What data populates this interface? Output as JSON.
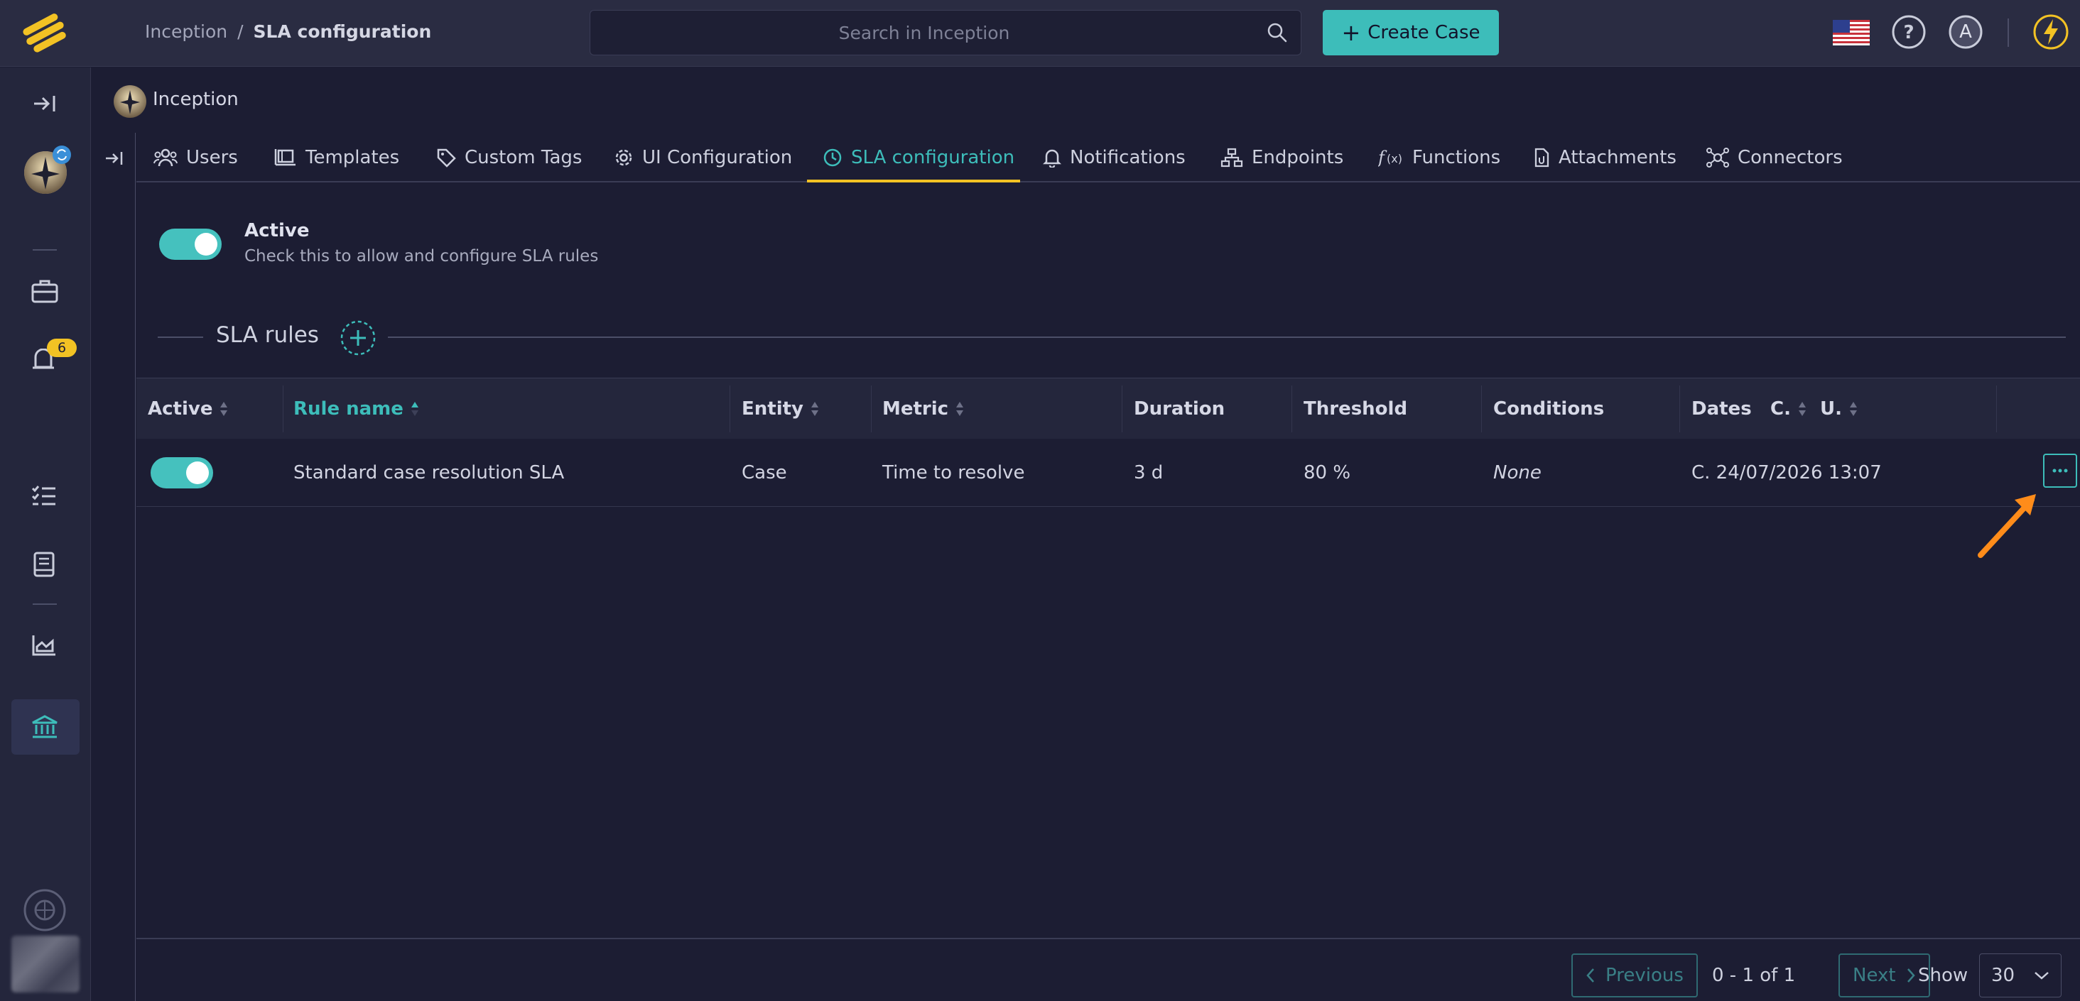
{
  "breadcrumb": {
    "root": "Inception",
    "separator": "/",
    "current": "SLA configuration"
  },
  "search": {
    "placeholder": "Search in Inception"
  },
  "header": {
    "create_label": "Create Case"
  },
  "user": {
    "initial": "A"
  },
  "sidebar": {
    "notification_count": "6"
  },
  "workspace": {
    "name": "Inception"
  },
  "tabs": [
    {
      "label": "Users",
      "icon": "users-icon"
    },
    {
      "label": "Templates",
      "icon": "templates-icon"
    },
    {
      "label": "Custom Tags",
      "icon": "tag-icon"
    },
    {
      "label": "UI Configuration",
      "icon": "gear-icon"
    },
    {
      "label": "SLA configuration",
      "icon": "clock-icon",
      "active": true
    },
    {
      "label": "Notifications",
      "icon": "bell-icon"
    },
    {
      "label": "Endpoints",
      "icon": "endpoints-icon"
    },
    {
      "label": "Functions",
      "icon": "function-icon"
    },
    {
      "label": "Attachments",
      "icon": "attachment-icon"
    },
    {
      "label": "Connectors",
      "icon": "connectors-icon"
    }
  ],
  "sla": {
    "active_label": "Active",
    "active_description": "Check this to allow and configure SLA rules",
    "rules_title": "SLA rules"
  },
  "table": {
    "columns": {
      "active": "Active",
      "rule_name": "Rule name",
      "entity": "Entity",
      "metric": "Metric",
      "duration": "Duration",
      "threshold": "Threshold",
      "conditions": "Conditions",
      "dates": "Dates",
      "created": "C.",
      "updated": "U."
    },
    "rows": [
      {
        "active": true,
        "rule_name": "Standard case resolution SLA",
        "entity": "Case",
        "metric": "Time to resolve",
        "duration": "3 d",
        "threshold": "80 %",
        "conditions": "None",
        "dates": "C. 24/07/2026 13:07"
      }
    ]
  },
  "pagination": {
    "previous": "Previous",
    "info": "0 - 1 of 1",
    "next": "Next",
    "show_label": "Show",
    "page_size": "30"
  },
  "colors": {
    "accent": "#3dbdba",
    "warning": "#f2c224",
    "background": "#1c1d33",
    "annotation": "#ff8c1a"
  }
}
